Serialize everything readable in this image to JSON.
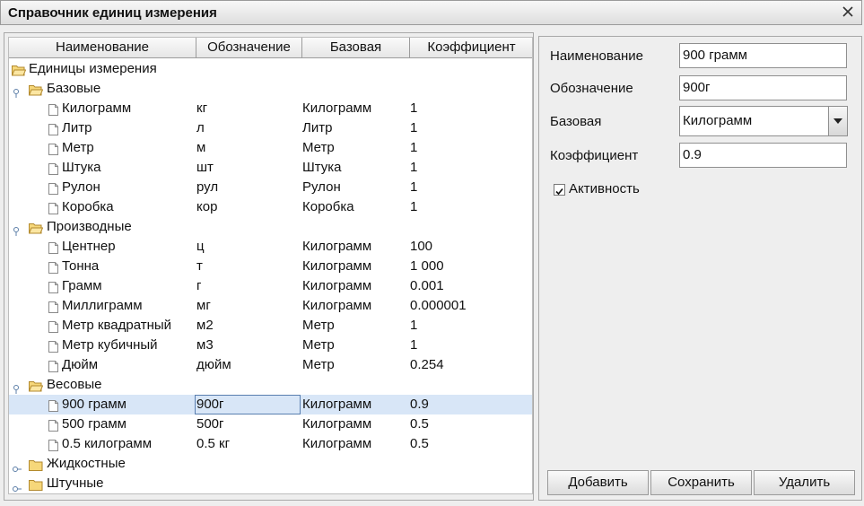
{
  "window": {
    "title": "Справочник единиц измерения"
  },
  "table": {
    "columns": [
      "Наименование",
      "Обозначение",
      "Базовая",
      "Коэффициент"
    ],
    "root": "Единицы измерения",
    "groups": [
      {
        "label": "Базовые",
        "expanded": true,
        "rows": [
          [
            "Килограмм",
            "кг",
            "Килограмм",
            "1"
          ],
          [
            "Литр",
            "л",
            "Литр",
            "1"
          ],
          [
            "Метр",
            "м",
            "Метр",
            "1"
          ],
          [
            "Штука",
            "шт",
            "Штука",
            "1"
          ],
          [
            "Рулон",
            "рул",
            "Рулон",
            "1"
          ],
          [
            "Коробка",
            "кор",
            "Коробка",
            "1"
          ]
        ]
      },
      {
        "label": "Производные",
        "expanded": true,
        "rows": [
          [
            "Центнер",
            "ц",
            "Килограмм",
            "100"
          ],
          [
            "Тонна",
            "т",
            "Килограмм",
            "1 000"
          ],
          [
            "Грамм",
            "г",
            "Килограмм",
            "0.001"
          ],
          [
            "Миллиграмм",
            "мг",
            "Килограмм",
            "0.000001"
          ],
          [
            "Метр квадратный",
            "м2",
            "Метр",
            "1"
          ],
          [
            "Метр кубичный",
            "м3",
            "Метр",
            "1"
          ],
          [
            "Дюйм",
            "дюйм",
            "Метр",
            "0.254"
          ]
        ]
      },
      {
        "label": "Весовые",
        "expanded": true,
        "rows": [
          [
            "900 грамм",
            "900г",
            "Килограмм",
            "0.9"
          ],
          [
            "500 грамм",
            "500г",
            "Килограмм",
            "0.5"
          ],
          [
            "0.5 килограмм",
            "0.5 кг",
            "Килограмм",
            "0.5"
          ]
        ]
      },
      {
        "label": "Жидкостные",
        "expanded": false,
        "rows": []
      },
      {
        "label": "Штучные",
        "expanded": false,
        "rows": []
      }
    ],
    "selected_row": "900 грамм"
  },
  "form": {
    "name_label": "Наименование",
    "name_value": "900 грамм",
    "symbol_label": "Обозначение",
    "symbol_value": "900г",
    "base_label": "Базовая",
    "base_value": "Килограмм",
    "coef_label": "Коэффициент",
    "coef_value": "0.9",
    "active_label": "Активность",
    "active_checked": true
  },
  "buttons": {
    "add": "Добавить",
    "save": "Сохранить",
    "delete": "Удалить"
  }
}
